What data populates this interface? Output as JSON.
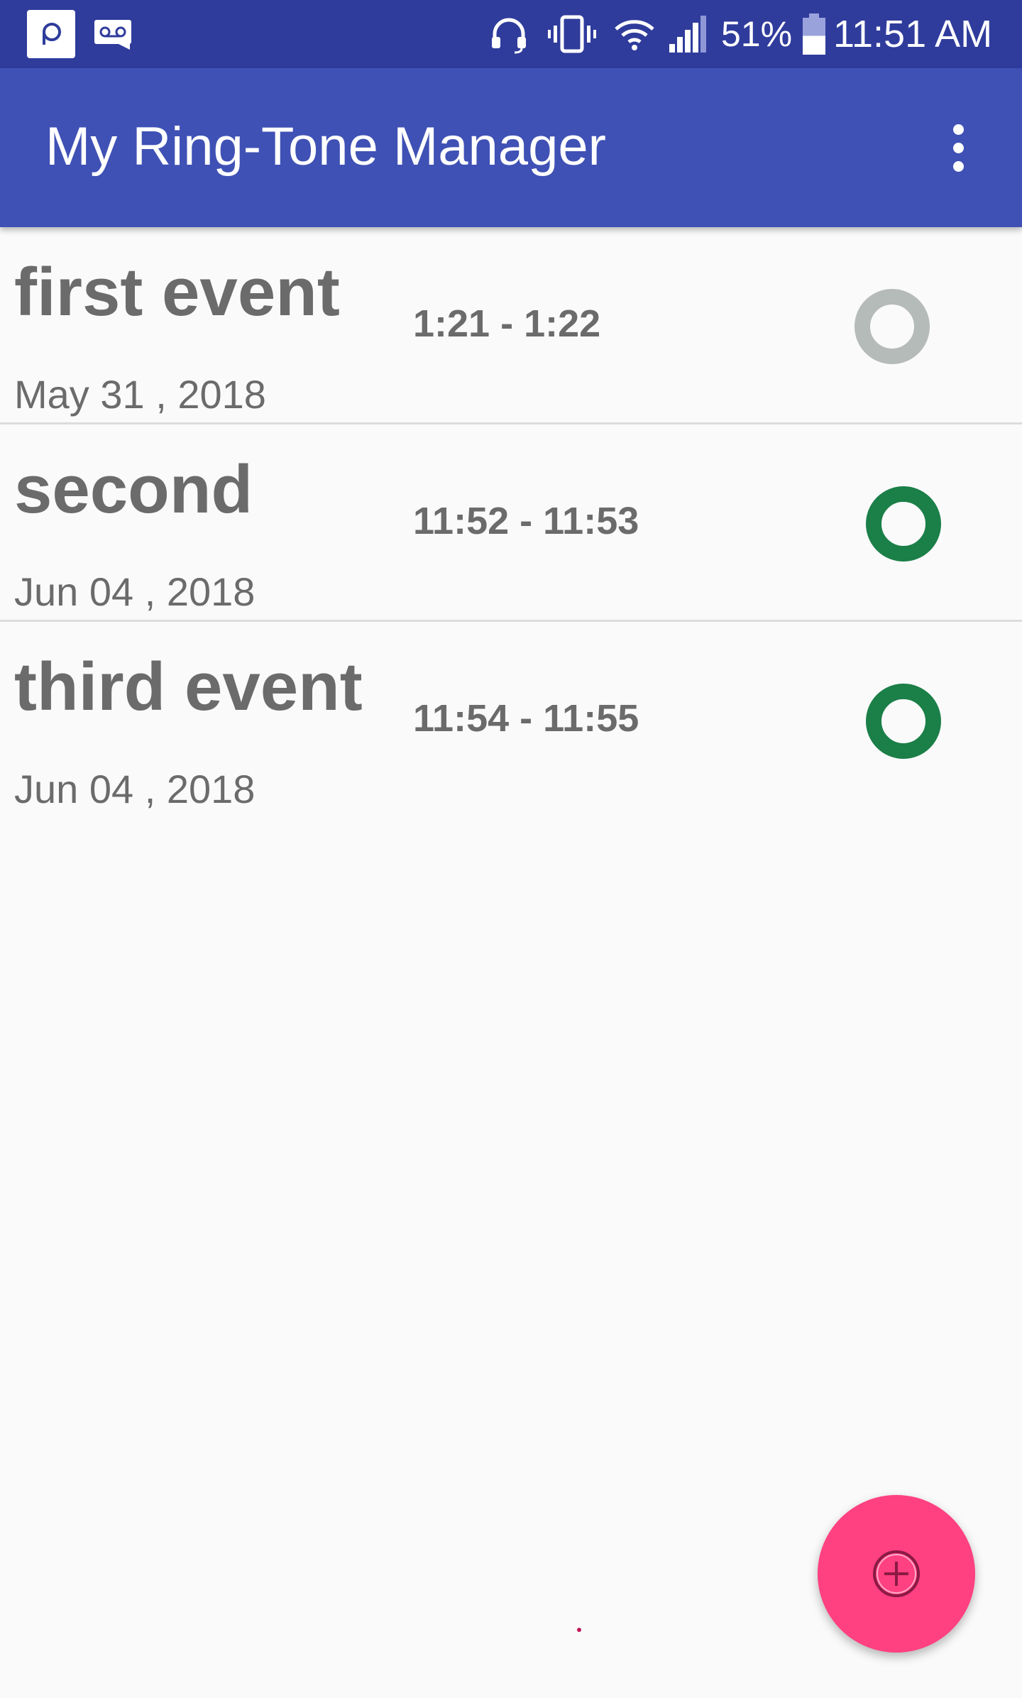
{
  "status_bar": {
    "battery_percent": "51%",
    "time": "11:51 AM",
    "battery_level": 0.51,
    "icons": [
      "app-notification-icon",
      "voicemail-icon",
      "headset-icon",
      "vibrate-icon",
      "wifi-icon",
      "cell-signal-icon",
      "battery-icon"
    ]
  },
  "app_bar": {
    "title": "My Ring-Tone Manager",
    "menu_icon": "more-vert-icon"
  },
  "events": [
    {
      "name": "first event",
      "time_range": "1:21 - 1:22",
      "date": "May 31 , 2018",
      "active": false
    },
    {
      "name": "second",
      "time_range": "11:52 - 11:53",
      "date": "Jun 04 , 2018",
      "active": true
    },
    {
      "name": "third event",
      "time_range": "11:54 - 11:55",
      "date": "Jun 04 , 2018",
      "active": true
    }
  ],
  "fab": {
    "icon": "add-circle-icon"
  },
  "colors": {
    "status_bar": "#2f3c9c",
    "app_bar": "#3f51b5",
    "active_toggle": "#1b7f48",
    "inactive_toggle": "#b5bbb9",
    "fab": "#ff4081",
    "text": "#6b6b6b",
    "background": "#fafafa"
  }
}
